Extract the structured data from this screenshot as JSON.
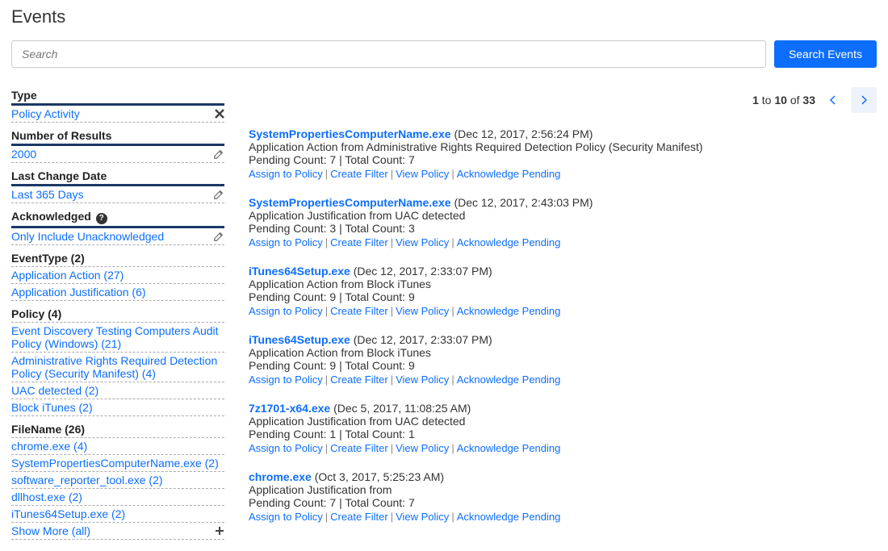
{
  "page": {
    "title": "Events"
  },
  "search": {
    "placeholder": "Search",
    "button": "Search Events"
  },
  "pagination": {
    "text_prefix": "1",
    "text_mid": " to ",
    "text_to": "10",
    "text_of": " of ",
    "text_total": "33"
  },
  "sidebar": {
    "filters": [
      {
        "label": "Type",
        "value": "Policy Activity",
        "action": "close"
      },
      {
        "label": "Number of Results",
        "value": "2000",
        "action": "edit"
      },
      {
        "label": "Last Change Date",
        "value": "Last 365 Days",
        "action": "edit"
      },
      {
        "label": "Acknowledged",
        "help": true,
        "value": "Only Include Unacknowledged",
        "action": "edit"
      }
    ],
    "facets": [
      {
        "label": "EventType (2)",
        "items": [
          "Application Action (27)",
          "Application Justification (6)"
        ]
      },
      {
        "label": "Policy (4)",
        "items": [
          "Event Discovery Testing Computers Audit Policy (Windows) (21)",
          "Administrative Rights Required Detection Policy (Security Manifest) (4)",
          "UAC detected (2)",
          "Block iTunes (2)"
        ]
      },
      {
        "label": "FileName (26)",
        "items": [
          "chrome.exe (4)",
          "SystemPropertiesComputerName.exe (2)",
          "software_reporter_tool.exe (2)",
          "dllhost.exe (2)",
          "iTunes64Setup.exe (2)"
        ],
        "showmore": "Show More (all)"
      }
    ]
  },
  "actions": {
    "assign": "Assign to Policy",
    "filter": "Create Filter",
    "view": "View Policy",
    "ack": "Acknowledge Pending"
  },
  "events": [
    {
      "filename": "SystemPropertiesComputerName.exe",
      "timestamp": "(Dec 12, 2017, 2:56:24 PM)",
      "description": "Application Action from Administrative Rights Required Detection Policy (Security Manifest)",
      "counts": "Pending Count: 7 | Total Count: 7"
    },
    {
      "filename": "SystemPropertiesComputerName.exe",
      "timestamp": "(Dec 12, 2017, 2:43:03 PM)",
      "description": "Application Justification from UAC detected",
      "counts": "Pending Count: 3 | Total Count: 3"
    },
    {
      "filename": "iTunes64Setup.exe",
      "timestamp": "(Dec 12, 2017, 2:33:07 PM)",
      "description": "Application Action from Block iTunes",
      "counts": "Pending Count: 9 | Total Count: 9"
    },
    {
      "filename": "iTunes64Setup.exe",
      "timestamp": "(Dec 12, 2017, 2:33:07 PM)",
      "description": "Application Action from Block iTunes",
      "counts": "Pending Count: 9 | Total Count: 9"
    },
    {
      "filename": "7z1701-x64.exe",
      "timestamp": "(Dec 5, 2017, 11:08:25 AM)",
      "description": "Application Justification from UAC detected",
      "counts": "Pending Count: 1 | Total Count: 1"
    },
    {
      "filename": "chrome.exe",
      "timestamp": "(Oct 3, 2017, 5:25:23 AM)",
      "description": "Application Justification from",
      "counts": "Pending Count: 7 | Total Count: 7"
    }
  ]
}
